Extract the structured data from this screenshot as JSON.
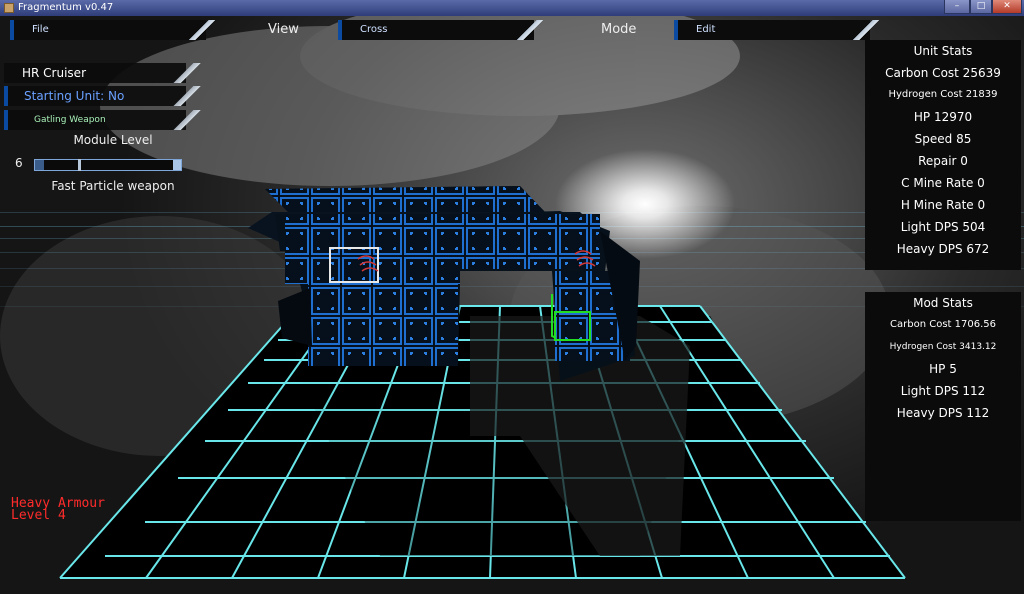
{
  "window": {
    "title": "Fragmentum v0.47",
    "minimize": "–",
    "maximize": "□",
    "close": "✕"
  },
  "menubar": {
    "file_label": "File",
    "view_caption": "View",
    "cross_label": "Cross",
    "mode_caption": "Mode",
    "edit_label": "Edit"
  },
  "left_panel": {
    "unit_name": "HR Cruiser",
    "starting_unit": "Starting Unit: No",
    "weapon": "Gatling Weapon",
    "module_level_label": "Module Level",
    "module_level_value": "6",
    "module_level_fraction": 0.06,
    "module_description": "Fast Particle weapon"
  },
  "unit_stats": {
    "title": "Unit Stats",
    "rows": [
      "Carbon Cost 25639",
      "Hydrogen Cost 21839",
      "HP 12970",
      "Speed 85",
      "Repair 0",
      "C Mine Rate 0",
      "H Mine Rate 0",
      "Light DPS 504",
      "Heavy DPS 672"
    ]
  },
  "mod_stats": {
    "title": "Mod Stats",
    "rows": [
      "Carbon Cost 1706.56",
      "Hydrogen Cost 3413.12",
      "HP 5",
      "Light DPS 112",
      "Heavy DPS 112"
    ]
  },
  "status": {
    "line1": "Heavy Armour",
    "line2": "Level 4"
  },
  "colors": {
    "grid": "#6ff3f6",
    "hull_accent": "#1e6fd0",
    "status_text": "#ff2b2b",
    "selection": "#22dd22"
  }
}
